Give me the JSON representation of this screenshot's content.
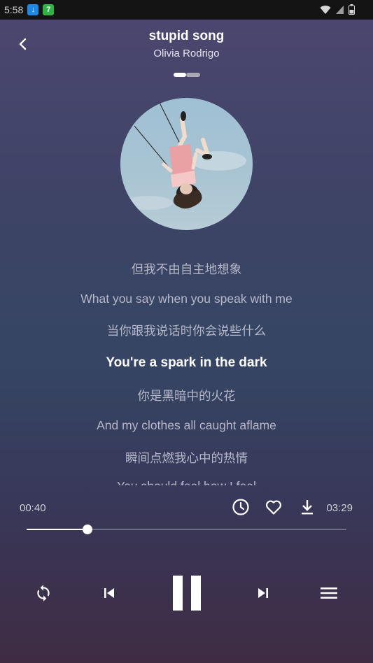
{
  "status_bar": {
    "time": "5:58",
    "app_icons": [
      {
        "name": "download-app-icon",
        "color": "#1e88e5",
        "glyph": "↓"
      },
      {
        "name": "seven-app-icon",
        "color": "#2fb344",
        "glyph": "7"
      }
    ]
  },
  "player": {
    "title": "stupid song",
    "artist": "Olivia Rodrigo",
    "pager": {
      "pages": 2,
      "active": 0
    }
  },
  "lyrics": [
    {
      "text": "但我不由自主地想象",
      "active": false
    },
    {
      "text": "What you say when you speak with me",
      "active": false
    },
    {
      "text": "当你跟我说话时你会说些什么",
      "active": false
    },
    {
      "text": "You're a spark in the dark",
      "active": true
    },
    {
      "text": "你是黑暗中的火花",
      "active": false
    },
    {
      "text": "And my clothes all caught aflame",
      "active": false
    },
    {
      "text": "瞬间点燃我心中的热情",
      "active": false
    },
    {
      "text": "You should feel how I feel",
      "active": false
    }
  ],
  "playback": {
    "current_time": "00:40",
    "total_time": "03:29",
    "progress_fraction": 0.191
  },
  "actions": {
    "icons": [
      "clock-icon",
      "heart-icon",
      "download-icon"
    ]
  },
  "controls": {
    "icons": [
      "repeat-icon",
      "previous-icon",
      "pause-icon",
      "next-icon",
      "playlist-icon"
    ]
  },
  "colors": {
    "bg_top": "#4d4670",
    "bg_bottom": "#3f2c43",
    "lyric_inactive": "#b5b7c8",
    "lyric_active": "#ffffff",
    "track": "#6b6e84"
  }
}
